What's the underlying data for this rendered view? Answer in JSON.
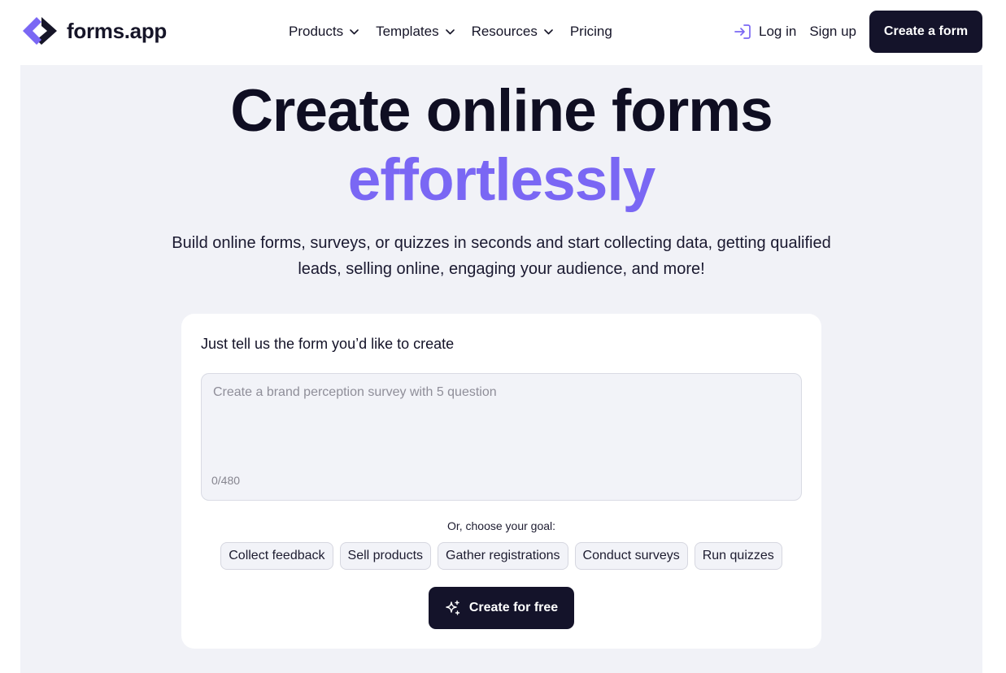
{
  "brand": {
    "name": "forms.app",
    "logo_icon": "forms-app-logo-icon",
    "accent_color": "#7a67f4",
    "dark_color": "#14132a"
  },
  "nav": {
    "items": [
      {
        "label": "Products",
        "has_dropdown": true
      },
      {
        "label": "Templates",
        "has_dropdown": true
      },
      {
        "label": "Resources",
        "has_dropdown": true
      },
      {
        "label": "Pricing",
        "has_dropdown": false
      }
    ]
  },
  "auth": {
    "login_icon": "login-arrow-icon",
    "login_label": "Log in",
    "signup_label": "Sign up",
    "create_label": "Create a form"
  },
  "hero": {
    "title": "Create online forms",
    "accent": "effortlessly",
    "subtitle": "Build online forms, surveys, or quizzes in seconds and start collecting data, getting qualified leads, selling online, engaging your audience, and more!"
  },
  "prompt_card": {
    "title": "Just tell us the form you’d like to create",
    "input_value": "",
    "input_placeholder": "Create a brand perception survey with 5 question",
    "counter": "0/480",
    "goal_label": "Or, choose your goal:",
    "goals": [
      "Collect feedback",
      "Sell products",
      "Gather registrations",
      "Conduct surveys",
      "Run quizzes"
    ],
    "submit_icon": "sparkle-icon",
    "submit_label": "Create for free"
  }
}
